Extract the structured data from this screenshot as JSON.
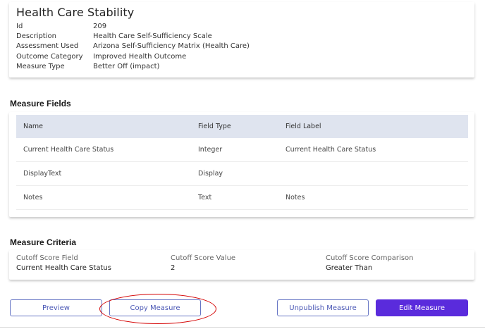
{
  "header": {
    "title": "Health Care Stability",
    "details": [
      {
        "label": "Id",
        "value": "209"
      },
      {
        "label": "Description",
        "value": "Health Care Self-Sufficiency Scale"
      },
      {
        "label": "Assessment Used",
        "value": "Arizona Self-Sufficiency Matrix (Health Care)"
      },
      {
        "label": "Outcome Category",
        "value": "Improved Health Outcome"
      },
      {
        "label": "Measure Type",
        "value": "Better Off (impact)"
      }
    ]
  },
  "fields": {
    "section_title": "Measure Fields",
    "columns": [
      "Name",
      "Field Type",
      "Field Label"
    ],
    "rows": [
      {
        "name": "Current Health Care Status",
        "type": "Integer",
        "label": "Current Health Care Status"
      },
      {
        "name": "DisplayText",
        "type": "Display",
        "label": ""
      },
      {
        "name": "Notes",
        "type": "Text",
        "label": "Notes"
      }
    ]
  },
  "criteria": {
    "section_title": "Measure Criteria",
    "columns": [
      {
        "label": "Cutoff Score Field",
        "value": "Current Health Care Status"
      },
      {
        "label": "Cutoff Score Value",
        "value": "2"
      },
      {
        "label": "Cutoff Score Comparison",
        "value": "Greater Than"
      }
    ]
  },
  "actions": {
    "preview": "Preview",
    "copy": "Copy Measure",
    "unpublish": "Unpublish Measure",
    "edit": "Edit Measure"
  },
  "colors": {
    "primary": "#5a2bdc",
    "outline": "#6675c4",
    "table_header": "#dfe4ef",
    "annotation": "#d40000"
  }
}
